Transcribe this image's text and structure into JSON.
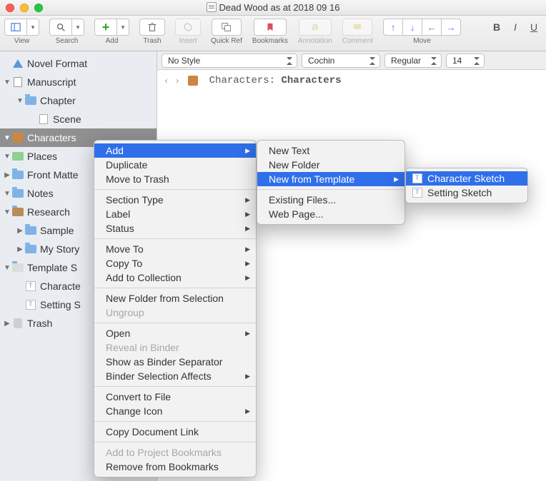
{
  "title": "Dead Wood as at 2018 09 16",
  "toolbar": {
    "view": "View",
    "search": "Search",
    "add": "Add",
    "trash": "Trash",
    "insert": "Insert",
    "quickref": "Quick Ref",
    "bookmarks": "Bookmarks",
    "annotation": "Annotation",
    "comment": "Comment",
    "move": "Move"
  },
  "binder": {
    "novel_format": "Novel Format",
    "manuscript": "Manuscript",
    "chapter": "Chapter",
    "scene": "Scene",
    "characters": "Characters",
    "places": "Places",
    "front_matter": "Front Matte",
    "notes": "Notes",
    "research": "Research",
    "sample": "Sample",
    "my_story": "My Story",
    "template_sheets": "Template S",
    "character_template": "Characte",
    "setting_template": "Setting S",
    "trash": "Trash"
  },
  "format": {
    "style": "No Style",
    "font": "Cochin",
    "weight": "Regular",
    "size": "14"
  },
  "breadcrumb": {
    "path": "Characters:",
    "doc": "Characters"
  },
  "menu_main": {
    "add": "Add",
    "duplicate": "Duplicate",
    "move_to_trash": "Move to Trash",
    "section_type": "Section Type",
    "label": "Label",
    "status": "Status",
    "move_to": "Move To",
    "copy_to": "Copy To",
    "add_to_collection": "Add to Collection",
    "new_folder_sel": "New Folder from Selection",
    "ungroup": "Ungroup",
    "open": "Open",
    "reveal": "Reveal in Binder",
    "binder_sep": "Show as Binder Separator",
    "binder_sel_aff": "Binder Selection Affects",
    "convert": "Convert to File",
    "change_icon": "Change Icon",
    "copy_link": "Copy Document Link",
    "add_bookmarks": "Add to Project Bookmarks",
    "remove_bookmarks": "Remove from Bookmarks"
  },
  "menu_add": {
    "new_text": "New Text",
    "new_folder": "New Folder",
    "new_from_template": "New from Template",
    "existing": "Existing Files...",
    "web": "Web Page..."
  },
  "menu_template": {
    "char": "Character Sketch",
    "setting": "Setting Sketch"
  }
}
